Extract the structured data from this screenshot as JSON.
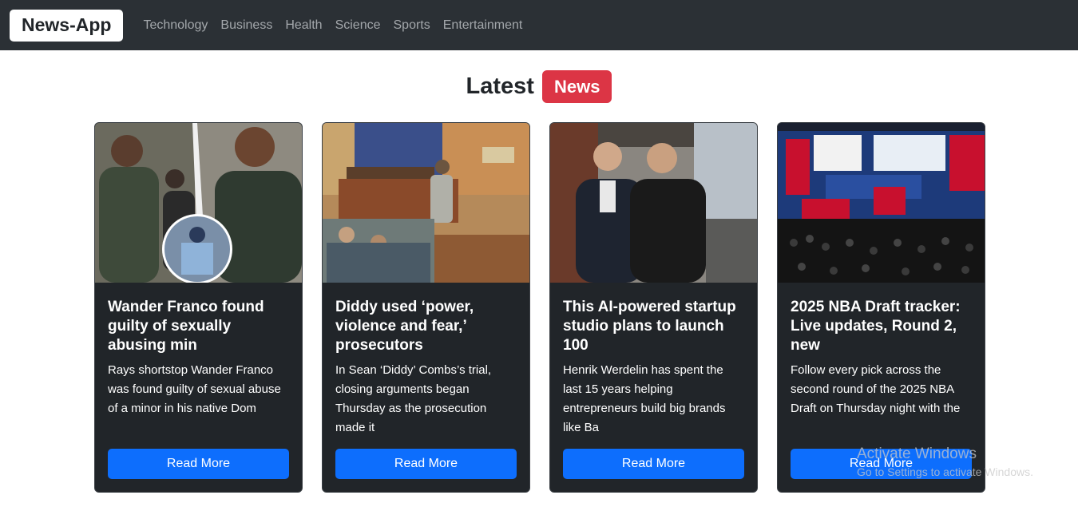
{
  "navbar": {
    "brand": "News-App",
    "links": [
      "Technology",
      "Business",
      "Health",
      "Science",
      "Sports",
      "Entertainment"
    ]
  },
  "heading": {
    "text": "Latest",
    "badge": "News"
  },
  "articles": [
    {
      "title": "Wander Franco found guilty of sexually abusing min",
      "description": "Rays shortstop Wander Franco was found guilty of sexual abuse of a minor in his native Dom",
      "button": "Read More"
    },
    {
      "title": "Diddy used ‘power, violence and fear,’ prosecutors",
      "description": "In Sean ‘Diddy’ Combs’s trial, closing arguments began Thursday as the prosecution made it",
      "button": "Read More"
    },
    {
      "title": "This AI-powered startup studio plans to launch 100",
      "description": "Henrik Werdelin has spent the last 15 years helping entrepreneurs build big brands like Ba",
      "button": "Read More"
    },
    {
      "title": "2025 NBA Draft tracker: Live updates, Round 2, new",
      "description": "Follow every pick across the second round of the 2025 NBA Draft on Thursday night with the",
      "button": "Read More"
    }
  ],
  "watermark": {
    "title": "Activate Windows",
    "subtitle": "Go to Settings to activate Windows."
  },
  "colors": {
    "navbar_bg": "#2b3035",
    "badge": "#dc3545",
    "card_bg": "#212529",
    "button": "#0d6efd"
  }
}
